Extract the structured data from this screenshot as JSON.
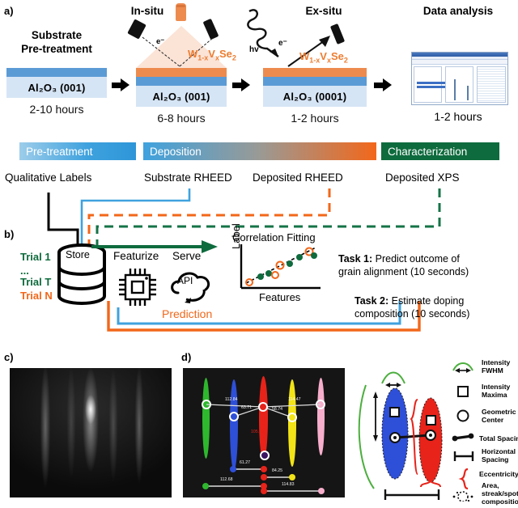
{
  "panels": {
    "a": "a)",
    "b": "b)",
    "c": "c)",
    "d": "d)"
  },
  "panel_a": {
    "steps": [
      {
        "title_line1": "Substrate",
        "title_line2": "Pre-treatment",
        "substrate_label": "Al₂O₃ (001)",
        "duration": "2-10 hours"
      },
      {
        "title_line1": "In-situ",
        "title_line2": "",
        "substrate_label": "Al₂O₃ (001)",
        "duration": "6-8 hours",
        "beam_label": "e⁻",
        "material": "W",
        "material_sub1": "1-x",
        "material_mid": "V",
        "material_sub2": "x",
        "material_end": "Se",
        "material_sub3": "2"
      },
      {
        "title_line1": "Ex-situ",
        "title_line2": "",
        "substrate_label": "Al₂O₃ (0001)",
        "duration": "1-2 hours",
        "photon_label": "hv",
        "electron_label": "e⁻"
      },
      {
        "title_line1": "Data analysis",
        "title_line2": "",
        "duration": "1-2 hours"
      }
    ]
  },
  "stage_bars": [
    {
      "label": "Pre-treatment",
      "color": "#3FA2DE"
    },
    {
      "label": "Deposition",
      "color": "#F2671A"
    },
    {
      "label": "Characterization",
      "color": "#0E6B3D"
    }
  ],
  "qualitative_labels": [
    {
      "label": "Qualitative Labels"
    },
    {
      "label": "Substrate RHEED"
    },
    {
      "label": "Deposited RHEED"
    },
    {
      "label": "Deposited XPS"
    }
  ],
  "panel_b": {
    "trials": [
      {
        "label": "Trial 1",
        "color": "#0E6B3D"
      },
      {
        "label": "...",
        "color": "#0E6B3D"
      },
      {
        "label": "Trial T",
        "color": "#0E6B3D"
      },
      {
        "label": "Trial N",
        "color": "#F2671A"
      }
    ],
    "store_label": "Store",
    "featurize_label": "Featurize",
    "serve_label": "Serve",
    "api_label": "API",
    "prediction_label": "Prediction",
    "plot": {
      "title": "Correlation Fitting",
      "ylabel": "Label",
      "xlabel": "Features"
    },
    "tasks": [
      {
        "name": "Task 1:",
        "line1": " Predict outcome of",
        "line2": "grain alignment (10 seconds)"
      },
      {
        "name": "Task 2:",
        "line1": " Estimate doping",
        "line2": "composition (10 seconds)"
      }
    ]
  },
  "panel_d": {
    "streak_colors": [
      "#2EB82E",
      "#2E4FD8",
      "#E8231A",
      "#F2E416",
      "#F6AECB"
    ],
    "measurements": [
      {
        "value": "112.84"
      },
      {
        "value": "63.71"
      },
      {
        "value": "114.47"
      },
      {
        "value": "58.74"
      },
      {
        "value": "105.72"
      },
      {
        "value": "61.27"
      },
      {
        "value": "84.25"
      },
      {
        "value": "112.68"
      },
      {
        "value": "114.83"
      }
    ],
    "legend": [
      {
        "line1": "Intensity",
        "line2": "FWHM"
      },
      {
        "line1": "Intensity",
        "line2": "Maxima"
      },
      {
        "line1": "Geometric",
        "line2": "Center"
      },
      {
        "line1": "Total Spacing",
        "line2": ""
      },
      {
        "line1": "Horizontal",
        "line2": "Spacing"
      },
      {
        "line1": "Eccentricity",
        "line2": ""
      },
      {
        "line1": "Area,",
        "line2": "streak/spot",
        "line3": "composition"
      }
    ]
  }
}
